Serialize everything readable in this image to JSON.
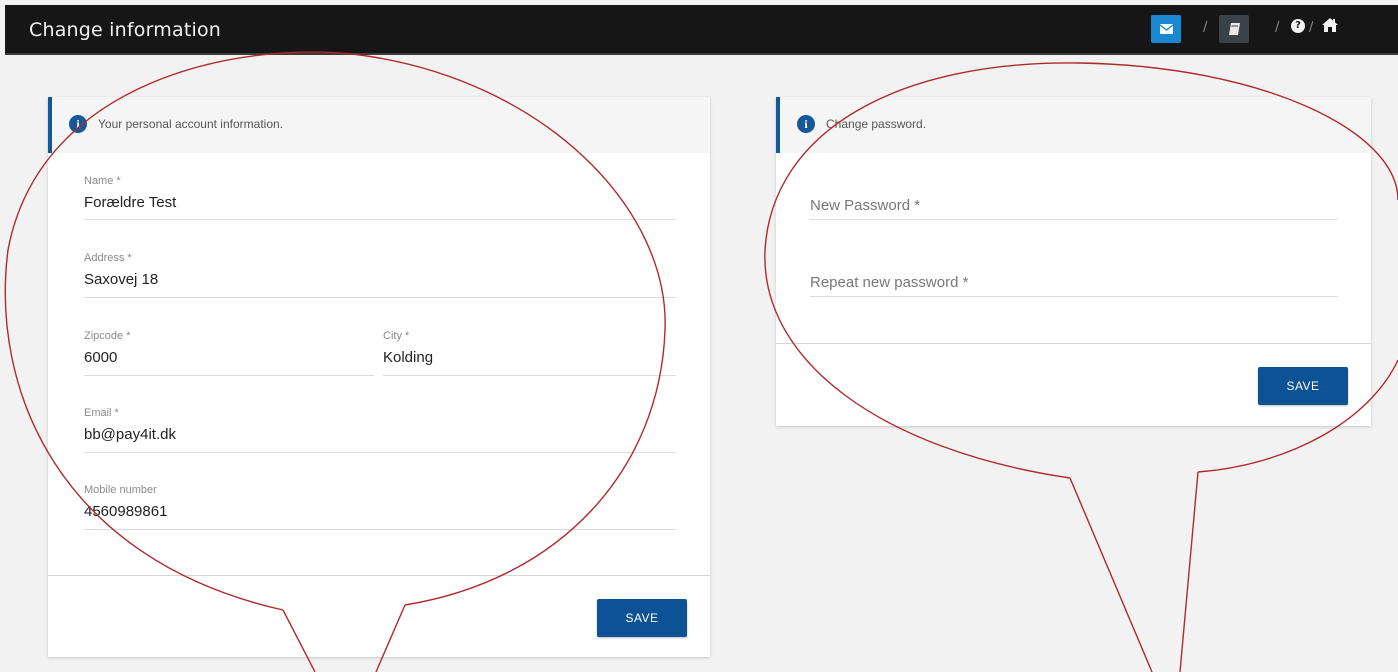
{
  "header": {
    "title": "Change information",
    "sep1": "/",
    "sep2": "/",
    "sep3": "/",
    "help_glyph": "?",
    "icons": [
      "mail-icon",
      "book-icon",
      "help-icon",
      "home-icon"
    ],
    "colors": {
      "bar": "#161616",
      "mail_button": "#1a88d0",
      "book_button": "#3b4149"
    }
  },
  "account": {
    "info_text": "Your personal account information.",
    "name_label": "Name *",
    "name_value": "Forældre Test",
    "address_label": "Address *",
    "address_value": "Saxovej 18",
    "zip_label": "Zipcode *",
    "zip_value": "6000",
    "city_label": "City *",
    "city_value": "Kolding",
    "email_label": "Email *",
    "email_value": "bb@pay4it.dk",
    "mobile_label": "Mobile number",
    "mobile_value": "4560989861",
    "save_label": "SAVE"
  },
  "password": {
    "info_text": "Change password.",
    "new_placeholder": "New Password *",
    "repeat_placeholder": "Repeat new password *",
    "save_label": "SAVE"
  },
  "colors": {
    "accent": "#10599c",
    "button": "#0c5294",
    "annotation": "#b02a2a"
  }
}
